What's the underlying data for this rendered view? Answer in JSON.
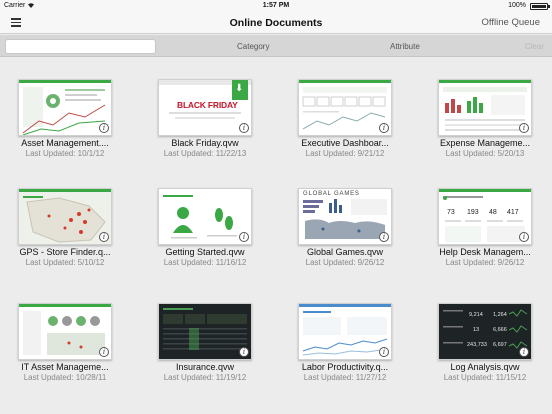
{
  "status": {
    "carrier": "Carrier",
    "time": "1:57 PM",
    "battery": "100%"
  },
  "nav": {
    "title": "Online Documents",
    "offline_queue": "Offline Queue"
  },
  "filter": {
    "search_placeholder": "",
    "category": "Category",
    "attribute": "Attribute",
    "clear": "Clear"
  },
  "documents": [
    {
      "name": "Asset Management....",
      "updated": "Last Updated: 10/1/12",
      "thumb": "asset"
    },
    {
      "name": "Black Friday.qvw",
      "updated": "Last Updated: 11/22/13",
      "thumb": "blackfriday",
      "thumb_text": "BLACK FRIDAY"
    },
    {
      "name": "Executive Dashboar...",
      "updated": "Last Updated: 9/21/12",
      "thumb": "exec"
    },
    {
      "name": "Expense Manageme...",
      "updated": "Last Updated: 5/20/13",
      "thumb": "expense"
    },
    {
      "name": "GPS - Store Finder.q...",
      "updated": "Last Updated: 5/10/12",
      "thumb": "gps"
    },
    {
      "name": "Getting Started.qvw",
      "updated": "Last Updated: 11/16/12",
      "thumb": "started"
    },
    {
      "name": "Global Games.qvw",
      "updated": "Last Updated: 9/26/12",
      "thumb": "games",
      "thumb_text": "GLOBAL GAMES"
    },
    {
      "name": "Help Desk Managem...",
      "updated": "Last Updated: 9/26/12",
      "thumb": "helpdesk",
      "thumb_values": [
        "73",
        "193",
        "48",
        "417"
      ]
    },
    {
      "name": "IT Asset Manageme...",
      "updated": "Last Updated: 10/28/11",
      "thumb": "itasset"
    },
    {
      "name": "Insurance.qvw",
      "updated": "Last Updated: 11/19/12",
      "thumb": "insurance"
    },
    {
      "name": "Labor Productivity.q...",
      "updated": "Last Updated: 11/27/12",
      "thumb": "labor"
    },
    {
      "name": "Log Analysis.qvw",
      "updated": "Last Updated: 11/15/12",
      "thumb": "log",
      "thumb_values": [
        "9,214",
        "13",
        "243,733",
        "1,264",
        "6,666",
        "6,697"
      ]
    }
  ],
  "colors": {
    "accent_green": "#3aa844",
    "black_friday_red": "#c4162a",
    "dark_thumb": "#1e2326"
  }
}
